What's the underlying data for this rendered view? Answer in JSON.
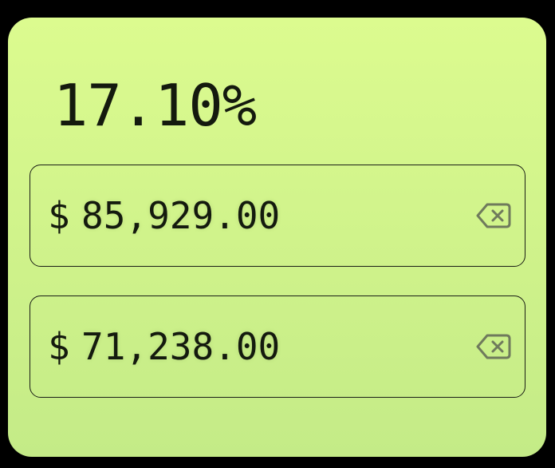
{
  "result": {
    "percentage": "17.10%"
  },
  "inputs": [
    {
      "currency_symbol": "$",
      "value": "85,929.00",
      "clear_icon": "backspace-clear-icon"
    },
    {
      "currency_symbol": "$",
      "value": "71,238.00",
      "clear_icon": "backspace-clear-icon"
    }
  ],
  "colors": {
    "background": "#000000",
    "card_top": "#dcfb8f",
    "card_bottom": "#c4eb87",
    "text": "#141a0e",
    "icon": "#6f7a5c"
  }
}
